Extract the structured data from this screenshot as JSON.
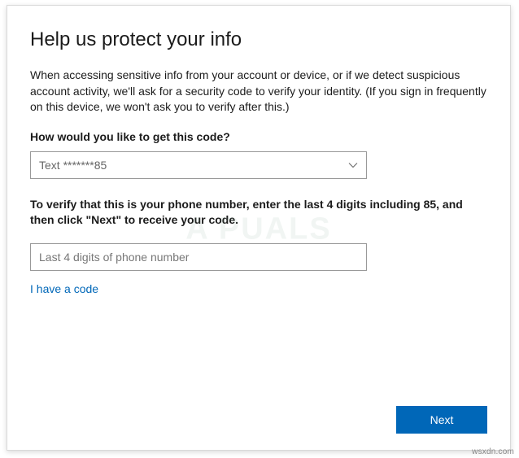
{
  "heading": "Help us protect your info",
  "description": "When accessing sensitive info from your account or device, or if we detect suspicious account activity, we'll ask for a security code to verify your identity. (If you sign in frequently on this device, we won't ask you to verify after this.)",
  "method_label": "How would you like to get this code?",
  "method_select": {
    "selected": "Text *******85"
  },
  "instruction": "To verify that this is your phone number, enter the last 4 digits including 85, and then click \"Next\" to receive your code.",
  "digits_input": {
    "placeholder": "Last 4 digits of phone number",
    "value": ""
  },
  "have_code_link": "I have a code",
  "next_button": "Next",
  "attribution": "wsxdn.com",
  "watermark": "A   PUALS"
}
